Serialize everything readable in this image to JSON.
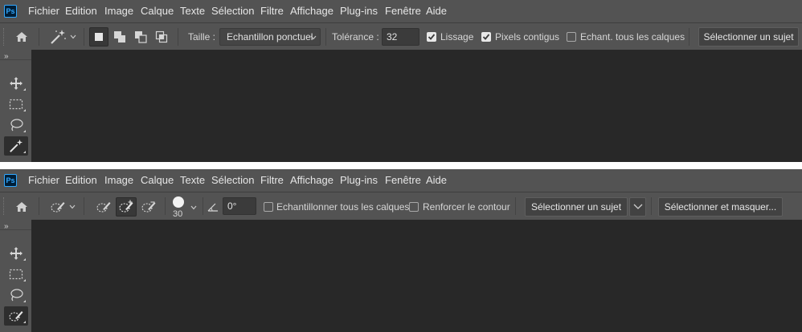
{
  "app": {
    "logo_text": "Ps"
  },
  "menu": [
    "Fichier",
    "Edition",
    "Image",
    "Calque",
    "Texte",
    "Sélection",
    "Filtre",
    "Affichage",
    "Plug-ins",
    "Fenêtre",
    "Aide"
  ],
  "magic_wand_options": {
    "taille_label": "Taille :",
    "taille_value": "Echantillon ponctuel",
    "tolerance_label": "Tolérance :",
    "tolerance_value": "32",
    "lissage_label": "Lissage",
    "lissage_checked": true,
    "pixels_contigus_label": "Pixels contigus",
    "pixels_contigus_checked": true,
    "echant_tous_calques_label": "Echant. tous les calques",
    "echant_tous_calques_checked": false,
    "select_subject_label": "Sélectionner un sujet"
  },
  "quick_select_options": {
    "brush_size": "30",
    "angle_value": "0°",
    "sample_all_layers_label": "Echantillonner tous les calques",
    "sample_all_layers_checked": false,
    "enhance_edge_label": "Renforcer le contour",
    "enhance_edge_checked": false,
    "select_subject_label": "Sélectionner un sujet",
    "select_mask_label": "Sélectionner et masquer..."
  },
  "toolbar": {
    "collapse_glyph": "»",
    "tools": [
      "move-tool",
      "marquee-tool",
      "lasso-tool",
      "selection-tool"
    ]
  },
  "colors": {
    "menubar": "#535353",
    "canvas": "#282828",
    "accent": "#31a8ff"
  }
}
